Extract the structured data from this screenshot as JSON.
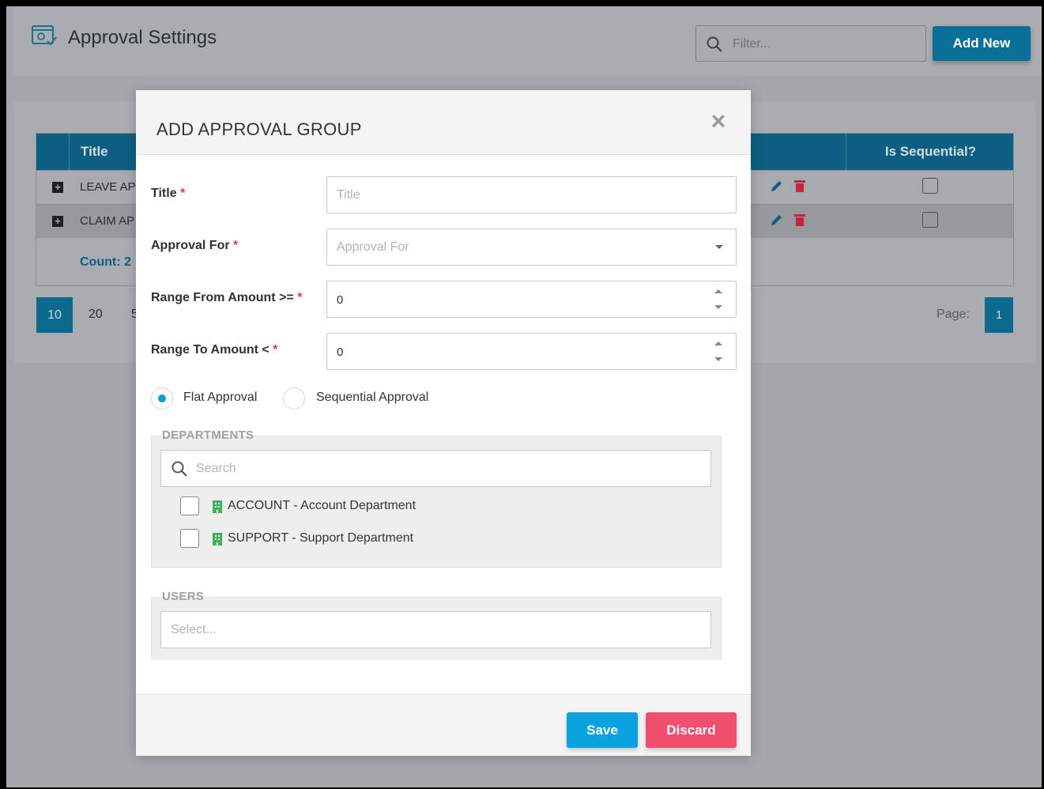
{
  "header": {
    "title": "Approval Settings",
    "filter_placeholder": "Filter...",
    "add_new_label": "Add New"
  },
  "grid": {
    "columns": [
      "Title",
      "Is Sequential?"
    ],
    "rows": [
      {
        "title": "LEAVE AP",
        "is_sequential": false
      },
      {
        "title": "CLAIM AP",
        "is_sequential": false
      }
    ],
    "count_label": "Count: 2"
  },
  "pager": {
    "sizes": [
      "10",
      "20",
      "5"
    ],
    "selected_size": "10",
    "page_label": "Page:",
    "current_page": "1"
  },
  "modal": {
    "title": "ADD APPROVAL GROUP",
    "close_glyph": "×",
    "fields": {
      "title": {
        "label": "Title",
        "placeholder": "Title",
        "value": ""
      },
      "approval_for": {
        "label": "Approval For",
        "placeholder": "Approval For",
        "value": ""
      },
      "range_from": {
        "label": "Range From Amount >=",
        "value": "0"
      },
      "range_to": {
        "label": "Range To Amount <",
        "value": "0"
      }
    },
    "required_mark": "*",
    "approval_type": {
      "options": [
        "Flat Approval",
        "Sequential Approval"
      ],
      "selected": "Flat Approval"
    },
    "departments": {
      "legend": "DEPARTMENTS",
      "search_placeholder": "Search",
      "items": [
        {
          "label": "ACCOUNT - Account Department",
          "checked": false
        },
        {
          "label": "SUPPORT - Support Department",
          "checked": false
        }
      ]
    },
    "users": {
      "legend": "USERS",
      "placeholder": "Select..."
    },
    "save_label": "Save",
    "discard_label": "Discard"
  },
  "colors": {
    "accent": "#0ba3df",
    "danger": "#f0506e",
    "required": "#e8334a",
    "grid_header": "#0c5f80"
  }
}
